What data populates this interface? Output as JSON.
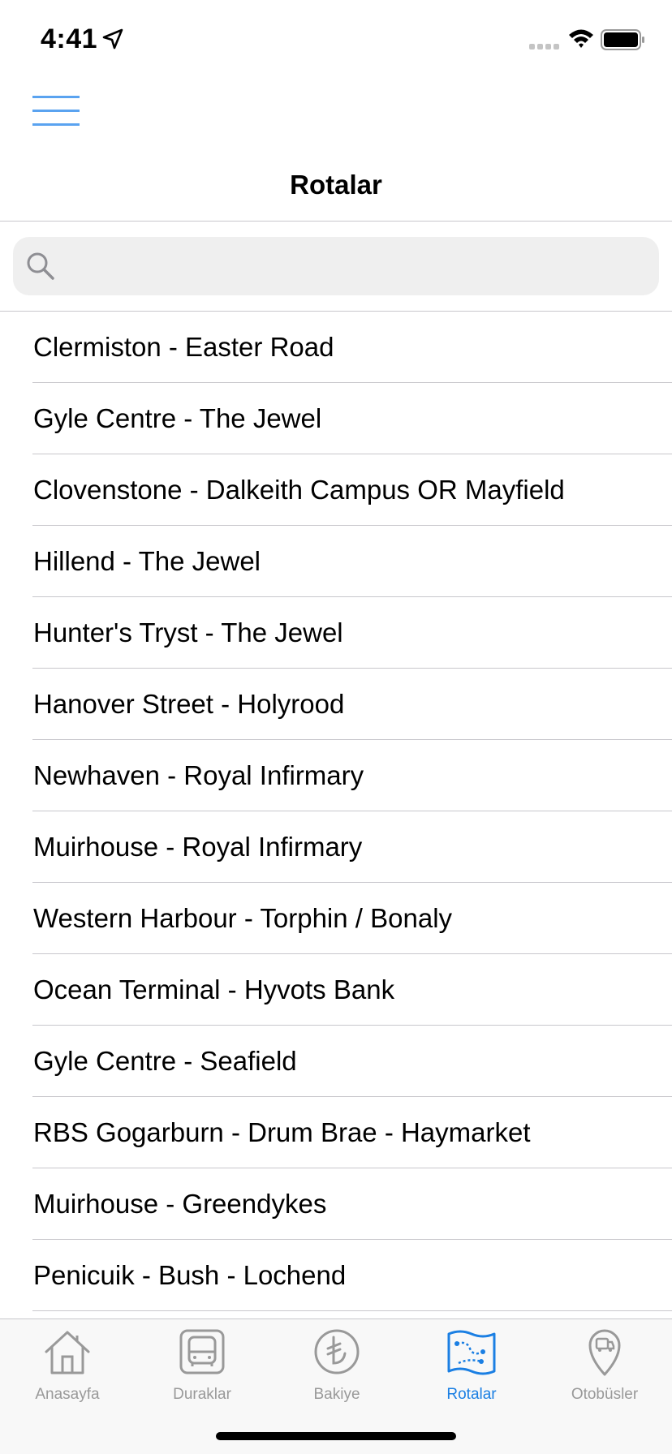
{
  "status_bar": {
    "time": "4:41",
    "icons": [
      "location-arrow-icon",
      "cellular-signal-icon",
      "wifi-icon",
      "battery-icon"
    ]
  },
  "nav": {
    "menu_icon": "hamburger-menu-icon",
    "title": "Rotalar"
  },
  "search": {
    "placeholder": "",
    "value": "",
    "icon": "search-icon"
  },
  "routes": [
    {
      "label": "Clermiston - Easter Road"
    },
    {
      "label": "Gyle Centre - The Jewel"
    },
    {
      "label": "Clovenstone - Dalkeith Campus OR Mayfield"
    },
    {
      "label": "Hillend - The Jewel"
    },
    {
      "label": "Hunter's Tryst - The Jewel"
    },
    {
      "label": "Hanover Street - Holyrood"
    },
    {
      "label": "Newhaven - Royal Infirmary"
    },
    {
      "label": "Muirhouse - Royal Infirmary"
    },
    {
      "label": "Western Harbour - Torphin / Bonaly"
    },
    {
      "label": "Ocean Terminal - Hyvots Bank"
    },
    {
      "label": "Gyle Centre - Seafield"
    },
    {
      "label": "RBS Gogarburn - Drum Brae - Haymarket"
    },
    {
      "label": "Muirhouse - Greendykes"
    },
    {
      "label": "Penicuik - Bush - Lochend"
    }
  ],
  "tabs": [
    {
      "label": "Anasayfa",
      "icon": "home-icon",
      "active": false
    },
    {
      "label": "Duraklar",
      "icon": "bus-stop-icon",
      "active": false
    },
    {
      "label": "Bakiye",
      "icon": "lira-icon",
      "active": false
    },
    {
      "label": "Rotalar",
      "icon": "route-map-icon",
      "active": true
    },
    {
      "label": "Otobüsler",
      "icon": "bus-location-icon",
      "active": false
    }
  ],
  "colors": {
    "accent": "#1b7fe3",
    "menu_icon": "#5aa3f0",
    "inactive_tab": "#999999",
    "separator": "#c8c7cc",
    "search_bg": "#efefef"
  }
}
